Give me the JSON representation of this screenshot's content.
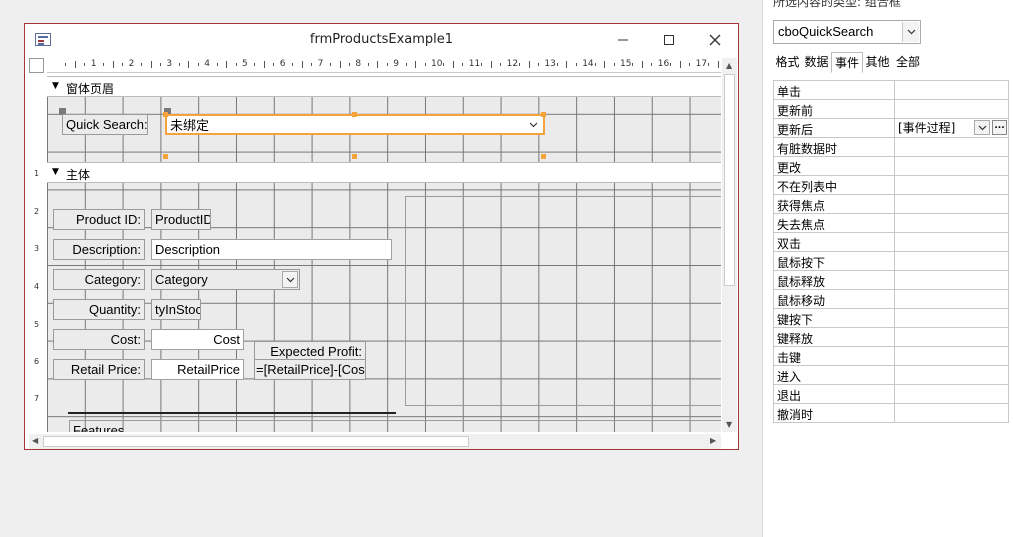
{
  "window": {
    "title": "frmProductsExample1",
    "controls": [
      "minimize-icon",
      "maximize-icon",
      "close-icon"
    ]
  },
  "ruler": {
    "h_numbers": [
      "1",
      "2",
      "3",
      "4",
      "5",
      "6",
      "7",
      "8",
      "9",
      "10",
      "11",
      "12",
      "13",
      "14",
      "15",
      "16",
      "17"
    ],
    "v_numbers": [
      "1",
      "2",
      "3",
      "4",
      "5",
      "6",
      "7"
    ]
  },
  "sections": {
    "form_header": "窗体页眉",
    "detail": "主体"
  },
  "header_controls": {
    "quick_search_label": "Quick Search:",
    "quick_search_value": "未绑定"
  },
  "detail_controls": {
    "product_id_label": "Product ID:",
    "product_id_value": "ProductID",
    "description_label": "Description:",
    "description_value": "Description",
    "category_label": "Category:",
    "category_value": "Category",
    "quantity_label": "Quantity:",
    "quantity_value": "tyInStoc",
    "cost_label": "Cost:",
    "cost_value": "Cost",
    "retail_price_label": "Retail Price:",
    "retail_price_value": "RetailPrice",
    "expected_profit_label": "Expected Profit:",
    "expected_profit_value": "=[RetailPrice]-[Cost",
    "features_label": "Features"
  },
  "property_sheet": {
    "selection_type": "所选内容的类型: 组合框",
    "object_name": "cboQuickSearch",
    "tabs": [
      "格式",
      "数据",
      "事件",
      "其他",
      "全部"
    ],
    "active_tab": "事件",
    "properties": [
      {
        "name": "单击",
        "value": ""
      },
      {
        "name": "更新前",
        "value": ""
      },
      {
        "name": "更新后",
        "value": "[事件过程]"
      },
      {
        "name": "有脏数据时",
        "value": ""
      },
      {
        "name": "更改",
        "value": ""
      },
      {
        "name": "不在列表中",
        "value": ""
      },
      {
        "name": "获得焦点",
        "value": ""
      },
      {
        "name": "失去焦点",
        "value": ""
      },
      {
        "name": "双击",
        "value": ""
      },
      {
        "name": "鼠标按下",
        "value": ""
      },
      {
        "name": "鼠标释放",
        "value": ""
      },
      {
        "name": "鼠标移动",
        "value": ""
      },
      {
        "name": "键按下",
        "value": ""
      },
      {
        "name": "键释放",
        "value": ""
      },
      {
        "name": "击键",
        "value": ""
      },
      {
        "name": "进入",
        "value": ""
      },
      {
        "name": "退出",
        "value": ""
      },
      {
        "name": "撤消时",
        "value": ""
      }
    ],
    "builder_button": "..."
  },
  "colors": {
    "window_border": "#a4373a",
    "selection": "#f5a33b",
    "grid_line": "#777777",
    "canvas": "#ebebeb"
  }
}
